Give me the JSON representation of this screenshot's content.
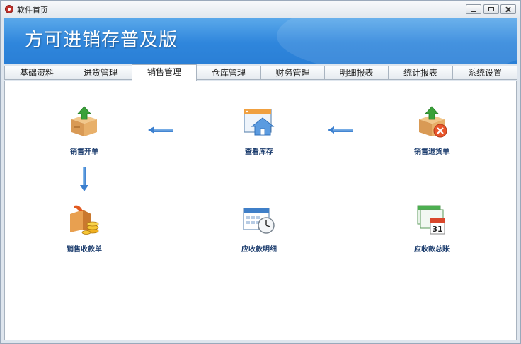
{
  "window": {
    "title": "软件首页"
  },
  "banner": {
    "title": "方可进销存普及版"
  },
  "tabs": [
    {
      "label": "基础资料"
    },
    {
      "label": "进货管理"
    },
    {
      "label": "销售管理",
      "active": true
    },
    {
      "label": "仓库管理"
    },
    {
      "label": "财务管理"
    },
    {
      "label": "明细报表"
    },
    {
      "label": "统计报表"
    },
    {
      "label": "系统设置"
    }
  ],
  "modules": {
    "sales_order": {
      "label": "销售开单",
      "icon": "box-upload-icon"
    },
    "view_stock": {
      "label": "查看库存",
      "icon": "house-window-icon"
    },
    "sales_return": {
      "label": "销售退货单",
      "icon": "box-return-icon"
    },
    "sales_receipt": {
      "label": "销售收款单",
      "icon": "box-coins-icon"
    },
    "receivable_detail": {
      "label": "应收款明细",
      "icon": "calendar-clock-icon"
    },
    "receivable_summary": {
      "label": "应收款总账",
      "icon": "calendar-31-icon"
    }
  },
  "calendar_day": "31",
  "colors": {
    "banner": "#2f86dc",
    "label": "#1c3d6e",
    "arrow": "#3b7fcf"
  }
}
